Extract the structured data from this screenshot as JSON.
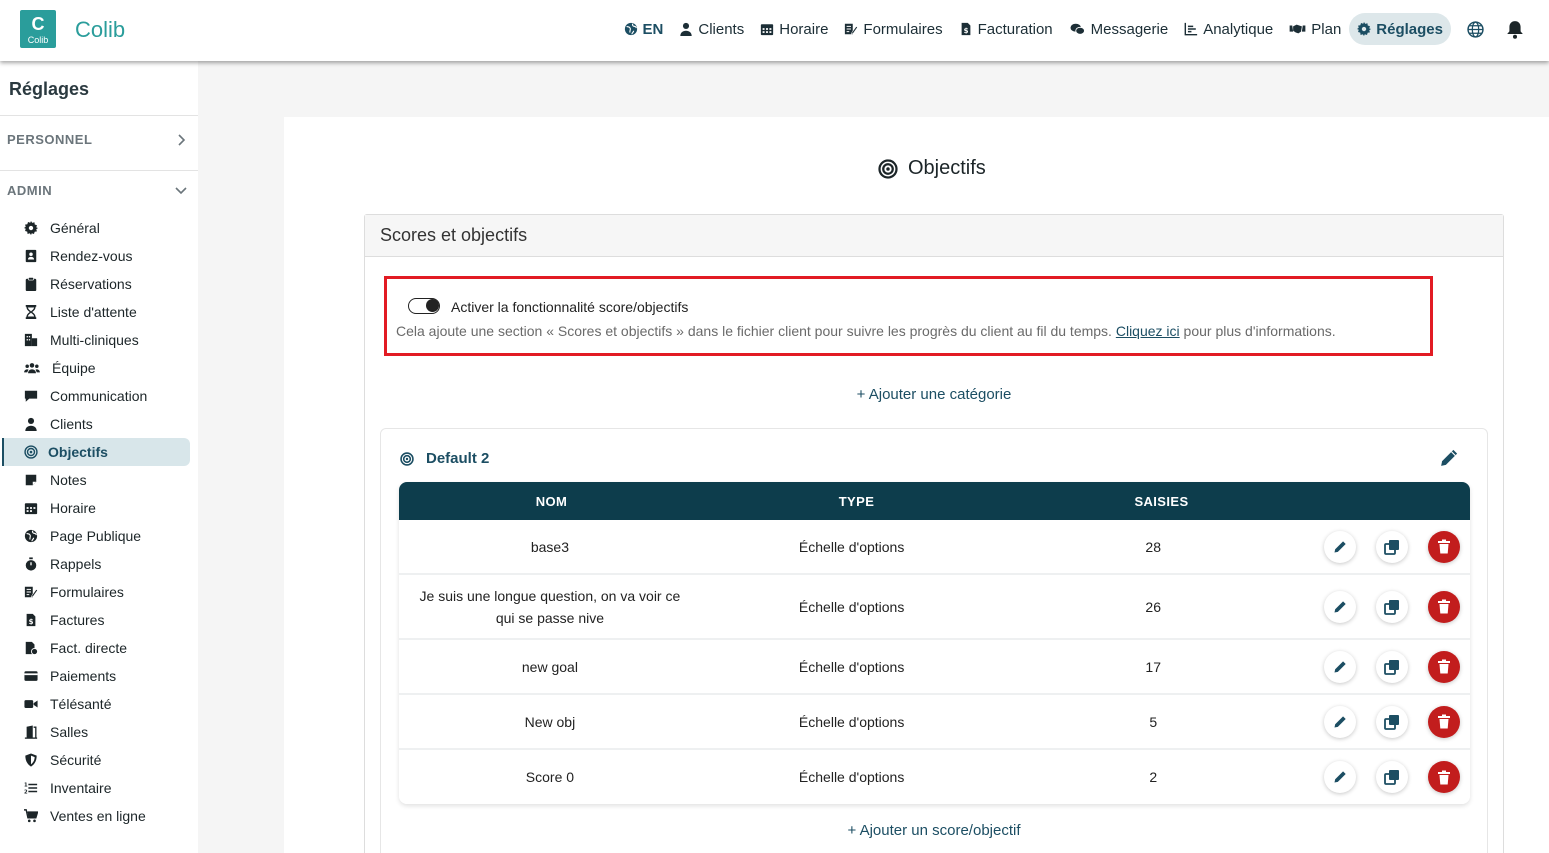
{
  "app": {
    "name": "Colib",
    "logo_letter": "C",
    "logo_text": "Colib"
  },
  "topnav": {
    "items": [
      {
        "id": "lang",
        "label": "EN",
        "icon": "globe-icon"
      },
      {
        "id": "clients",
        "label": "Clients",
        "icon": "user-icon"
      },
      {
        "id": "horaire",
        "label": "Horaire",
        "icon": "calendar-icon"
      },
      {
        "id": "formulaires",
        "label": "Formulaires",
        "icon": "form-icon"
      },
      {
        "id": "facturation",
        "label": "Facturation",
        "icon": "invoice-icon"
      },
      {
        "id": "messagerie",
        "label": "Messagerie",
        "icon": "chat-icon"
      },
      {
        "id": "analytique",
        "label": "Analytique",
        "icon": "chart-icon"
      },
      {
        "id": "plan",
        "label": "Plan",
        "icon": "handshake-icon"
      },
      {
        "id": "reglages",
        "label": "Réglages",
        "icon": "gear-icon",
        "active": true
      }
    ]
  },
  "sidebar": {
    "title": "Réglages",
    "personnel_label": "PERSONNEL",
    "admin_label": "ADMIN",
    "items": [
      {
        "label": "Général",
        "icon": "gear-icon"
      },
      {
        "label": "Rendez-vous",
        "icon": "contact-card-icon"
      },
      {
        "label": "Réservations",
        "icon": "clipboard-icon"
      },
      {
        "label": "Liste d'attente",
        "icon": "hourglass-icon"
      },
      {
        "label": "Multi-cliniques",
        "icon": "clinics-icon"
      },
      {
        "label": "Équipe",
        "icon": "team-icon"
      },
      {
        "label": "Communication",
        "icon": "comment-icon"
      },
      {
        "label": "Clients",
        "icon": "user-icon"
      },
      {
        "label": "Objectifs",
        "icon": "target-icon",
        "active": true
      },
      {
        "label": "Notes",
        "icon": "note-icon"
      },
      {
        "label": "Horaire",
        "icon": "calendar-icon"
      },
      {
        "label": "Page Publique",
        "icon": "globe-icon"
      },
      {
        "label": "Rappels",
        "icon": "stopwatch-icon"
      },
      {
        "label": "Formulaires",
        "icon": "form-icon"
      },
      {
        "label": "Factures",
        "icon": "invoice-icon"
      },
      {
        "label": "Fact. directe",
        "icon": "direct-invoice-icon"
      },
      {
        "label": "Paiements",
        "icon": "credit-card-icon"
      },
      {
        "label": "Télésanté",
        "icon": "video-icon"
      },
      {
        "label": "Salles",
        "icon": "door-icon"
      },
      {
        "label": "Sécurité",
        "icon": "shield-icon"
      },
      {
        "label": "Inventaire",
        "icon": "list-icon"
      },
      {
        "label": "Ventes en ligne",
        "icon": "cart-icon"
      }
    ]
  },
  "main": {
    "title": "Objectifs",
    "panel_title": "Scores et objectifs",
    "toggle": {
      "label": "Activer la fonctionnalité score/objectifs",
      "description_before": "Cela ajoute une section « Scores et objectifs » dans le fichier client pour suivre les progrès du client au fil du temps. ",
      "link_text": "Cliquez ici",
      "description_after": " pour plus d'informations.",
      "enabled": true
    },
    "add_category": "+ Ajouter une catégorie",
    "category": {
      "name": "Default 2",
      "columns": {
        "nom": "NOM",
        "type": "TYPE",
        "saisies": "SAISIES"
      },
      "rows": [
        {
          "nom": "base3",
          "type": "Échelle d'options",
          "saisies": "28"
        },
        {
          "nom": "Je suis une longue question, on va voir ce qui se passe nive",
          "type": "Échelle d'options",
          "saisies": "26"
        },
        {
          "nom": "new goal",
          "type": "Échelle d'options",
          "saisies": "17"
        },
        {
          "nom": "New obj",
          "type": "Échelle d'options",
          "saisies": "5"
        },
        {
          "nom": "Score 0",
          "type": "Échelle d'options",
          "saisies": "2"
        }
      ],
      "add_score": "+ Ajouter un score/objectif"
    }
  },
  "colors": {
    "brand": "#2a9d9b",
    "primary": "#1c4e63",
    "table_header": "#0d3d4c",
    "delete": "#c21d1d",
    "highlight": "#e21b23"
  }
}
